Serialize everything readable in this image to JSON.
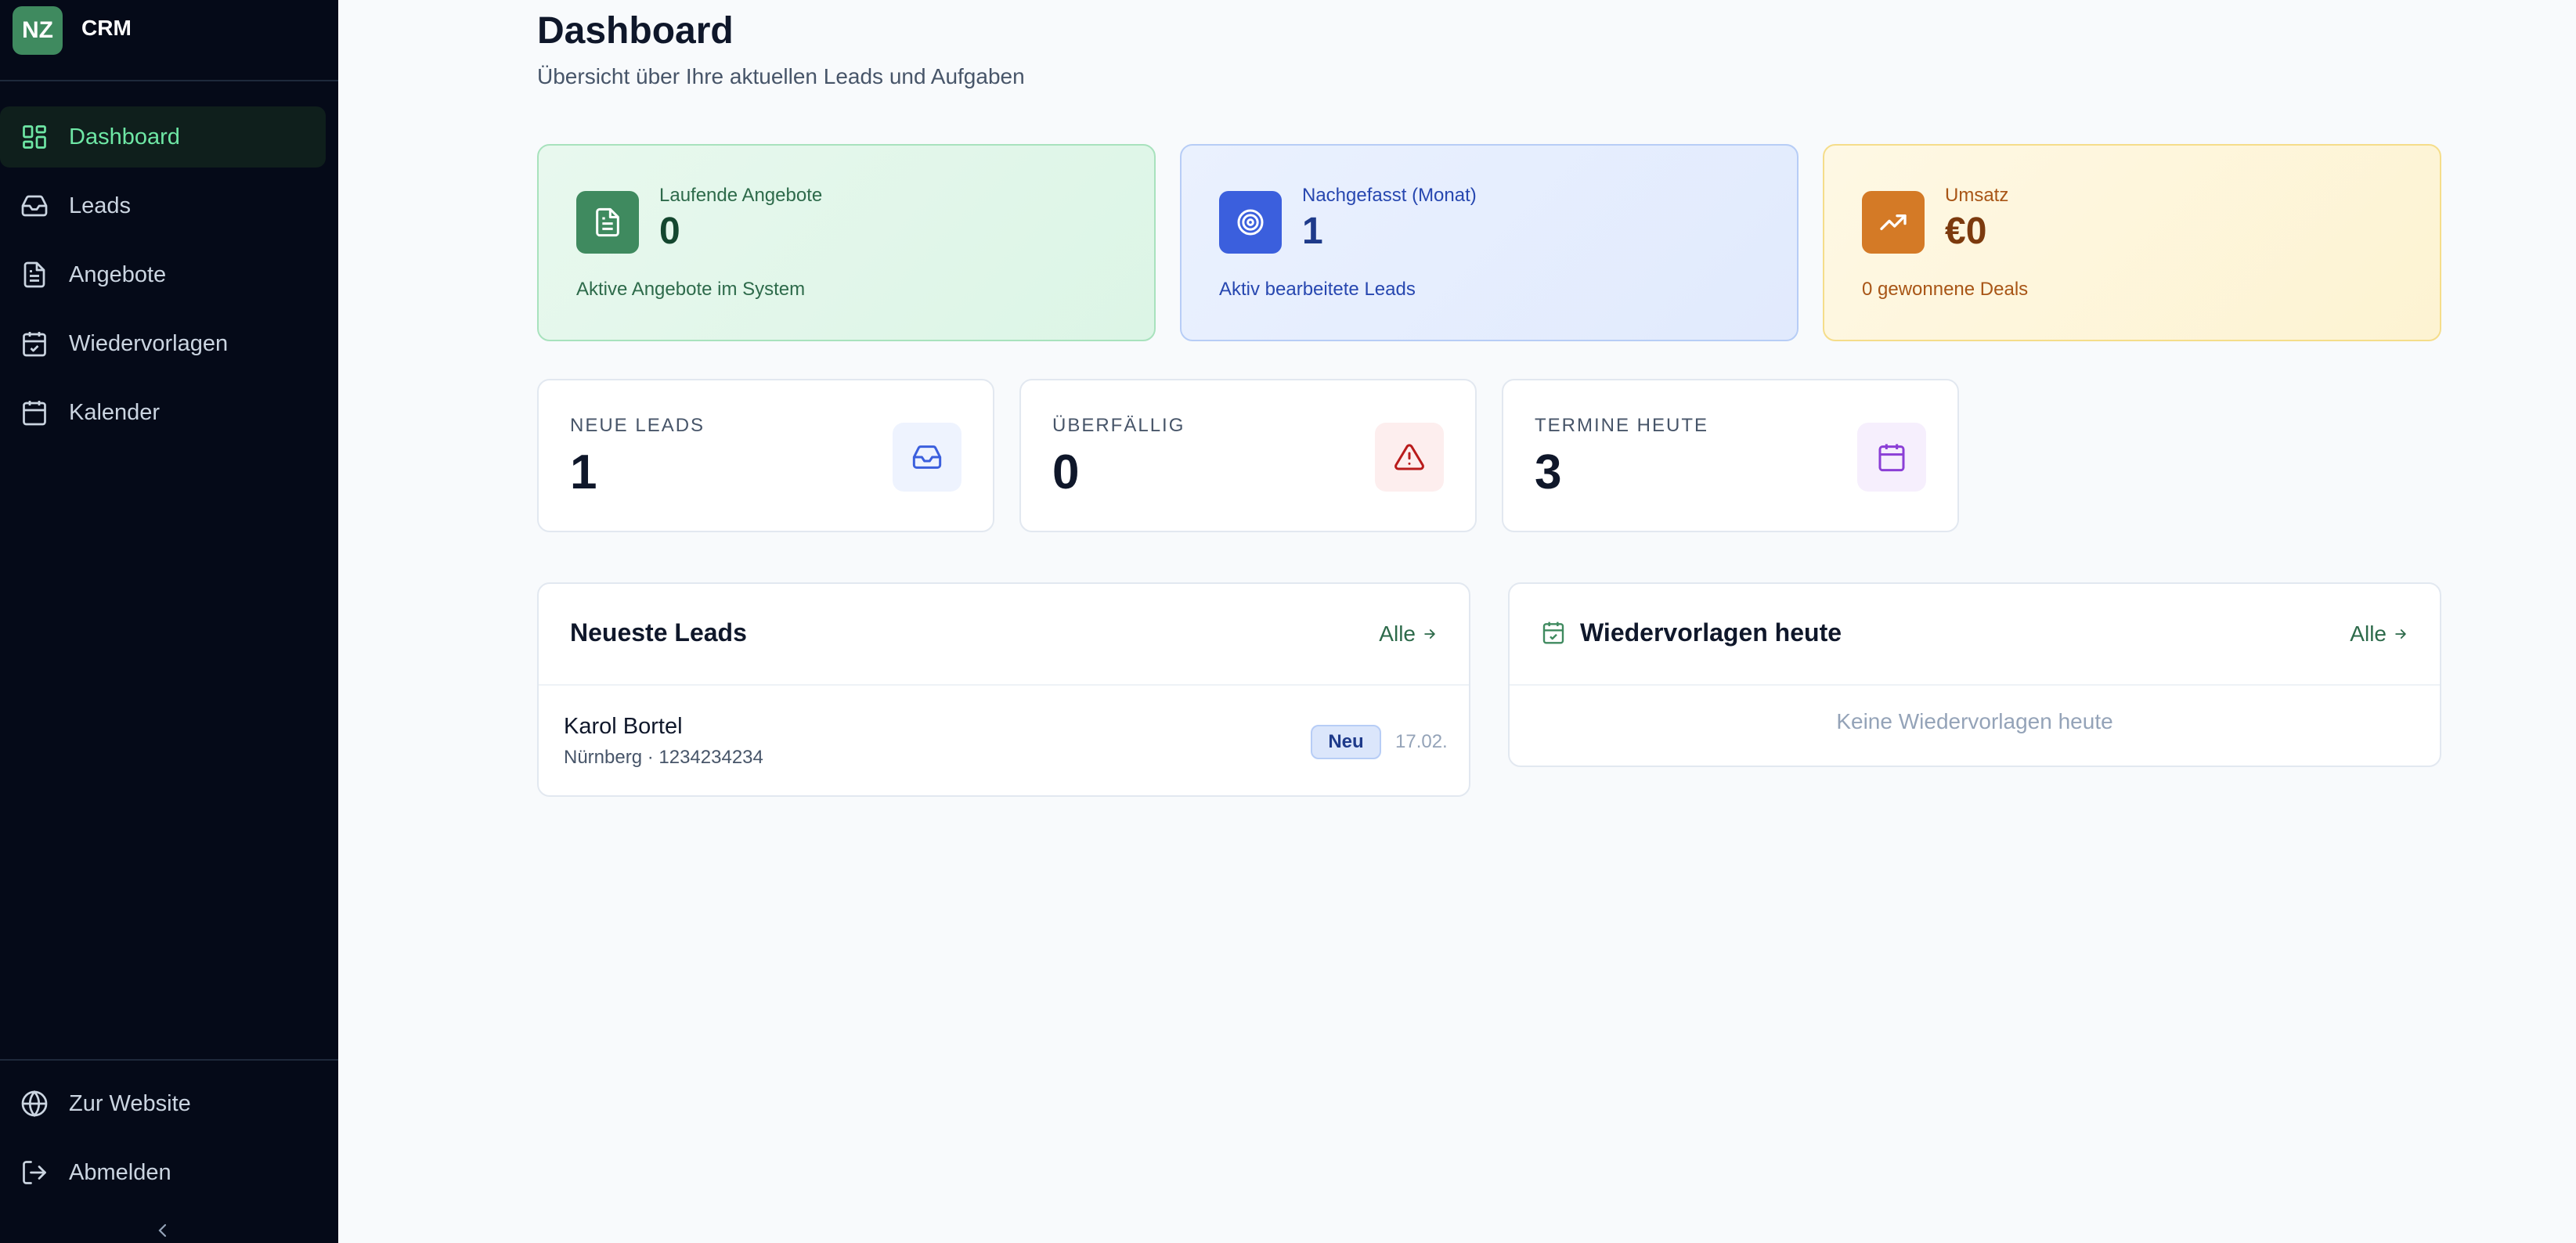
{
  "brand": {
    "initials": "NZ",
    "name": "CRM"
  },
  "sidebar": {
    "items": [
      {
        "label": "Dashboard",
        "icon": "dashboard-icon",
        "active": true
      },
      {
        "label": "Leads",
        "icon": "inbox-icon"
      },
      {
        "label": "Angebote",
        "icon": "document-icon"
      },
      {
        "label": "Wiedervorlagen",
        "icon": "calendar-check-icon"
      },
      {
        "label": "Kalender",
        "icon": "calendar-icon"
      }
    ],
    "footer": [
      {
        "label": "Zur Website",
        "icon": "globe-icon"
      },
      {
        "label": "Abmelden",
        "icon": "logout-icon"
      }
    ]
  },
  "header": {
    "title": "Dashboard",
    "subtitle": "Übersicht über Ihre aktuellen Leads und Aufgaben"
  },
  "kpis": [
    {
      "label": "Laufende Angebote",
      "value": "0",
      "sub": "Aktive Angebote im System",
      "icon": "document-icon",
      "color": "#3f8a5f"
    },
    {
      "label": "Nachgefasst (Monat)",
      "value": "1",
      "sub": "Aktiv bearbeitete Leads",
      "icon": "target-icon",
      "color": "#3b5fdd"
    },
    {
      "label": "Umsatz",
      "value": "€0",
      "sub": "0 gewonnene Deals",
      "icon": "trending-up-icon",
      "color": "#d47a26"
    }
  ],
  "stats": [
    {
      "label": "NEUE LEADS",
      "value": "1",
      "icon": "inbox-icon"
    },
    {
      "label": "ÜBERFÄLLIG",
      "value": "0",
      "icon": "warning-icon"
    },
    {
      "label": "TERMINE HEUTE",
      "value": "3",
      "icon": "calendar-icon"
    }
  ],
  "latest_leads": {
    "title": "Neueste Leads",
    "link": "Alle",
    "items": [
      {
        "name": "Karol Bortel",
        "meta": "Nürnberg · 1234234234",
        "badge": "Neu",
        "date": "17.02."
      }
    ]
  },
  "followups_today": {
    "title": "Wiedervorlagen heute",
    "link": "Alle",
    "empty": "Keine Wiedervorlagen heute"
  }
}
